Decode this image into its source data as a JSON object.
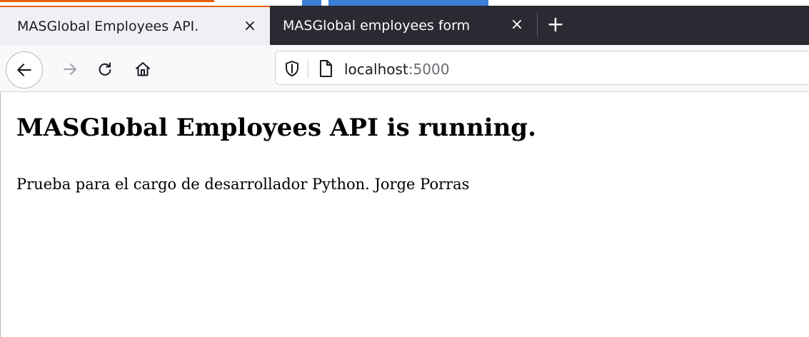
{
  "colors": {
    "tabbar_bg": "#2b2a33",
    "active_tab_bg": "#f0f0f4",
    "accent": "#e66000",
    "navbar_bg": "#f9f9fb",
    "highlight": "#3b7ed6"
  },
  "top_fragment": "...g/g...",
  "tabs": [
    {
      "title": "MASGlobal Employees API.",
      "close_icon": "close-icon",
      "active": true
    },
    {
      "title": "MASGlobal employees form",
      "close_icon": "close-icon",
      "active": false
    }
  ],
  "tabbar": {
    "new_tab_label": "+"
  },
  "nav": {
    "back_icon": "arrow-left-icon",
    "forward_icon": "arrow-right-icon",
    "reload_icon": "reload-icon",
    "home_icon": "home-icon"
  },
  "urlbar": {
    "shield_icon": "shield-icon",
    "page_icon": "page-icon",
    "host": "localhost",
    "port": ":5000"
  },
  "page": {
    "heading": "MASGlobal Employees API is running.",
    "paragraph": "Prueba para el cargo de desarrollador Python. Jorge Porras"
  }
}
